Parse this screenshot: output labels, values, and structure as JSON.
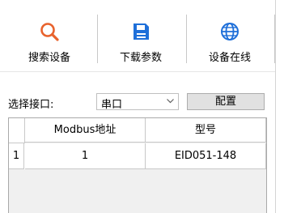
{
  "toolbar": {
    "search_label": "搜索设备",
    "download_label": "下载参数",
    "online_label": "设备在线"
  },
  "port": {
    "label": "选择接口:",
    "selected": "串口",
    "config_button": "配置"
  },
  "table": {
    "columns": [
      "Modbus地址",
      "型号"
    ],
    "rows": [
      {
        "index": "1",
        "address": "1",
        "model": "EID051-148"
      }
    ]
  },
  "colors": {
    "search_icon": "#e8622c",
    "download_icon": "#1e6fd9",
    "online_icon": "#1e6fd9"
  }
}
